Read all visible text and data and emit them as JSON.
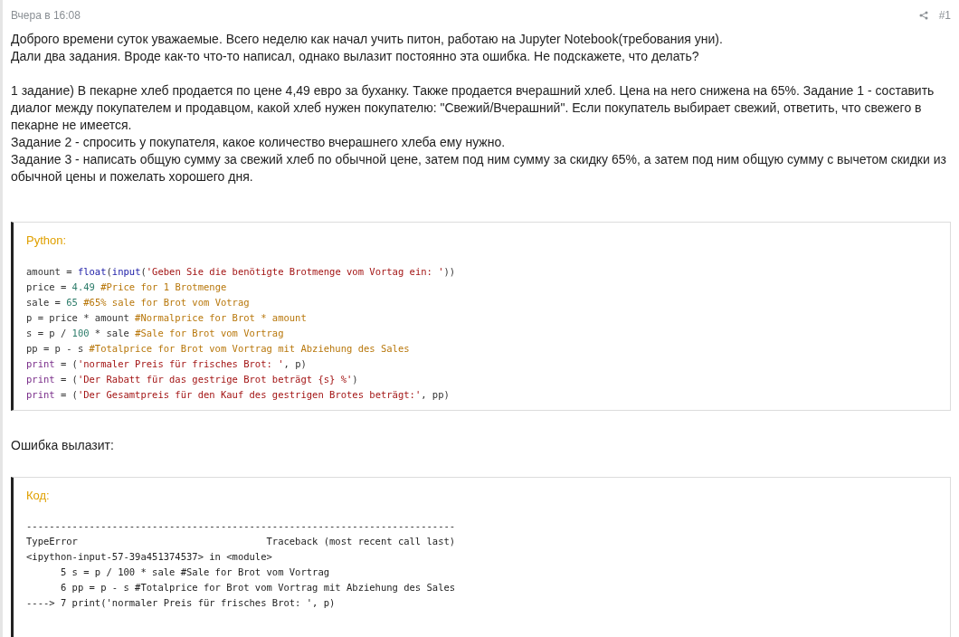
{
  "post": {
    "time": "Вчера в 16:08",
    "number": "#1"
  },
  "paragraphs": [
    "Доброго времени суток уважаемые. Всего неделю как начал учить питон, работаю на Jupyter Notebook(требования уни).\nДали два задания. Вроде как-то что-то написал, однако вылазит постоянно эта ошибка. Не подскажете, что делать?",
    "1 задание) В пекарне хлеб продается по цене 4,49 евро за буханку. Также продается вчерашний хлеб. Цена на него снижена на 65%. Задание 1 - составить диалог между покупателем и продавцом, какой хлеб нужен покупателю: \"Свежий/Вчерашний\". Если покупатель выбирает свежий, ответить, что свежего в пекарне не имеется.\nЗадание 2 - спросить у покупателя, какое количество вчерашнего хлеба ему нужно.\nЗадание 3 - написать общую сумму за свежий хлеб по обычной цене, затем под ним сумму за скидку 65%, а затем под ним общую сумму с вычетом скидки из обычной цены и пожелать хорошего дня."
  ],
  "code_block": {
    "label": "Python:",
    "lines": [
      [
        {
          "kind": "plain",
          "text": "amount = "
        },
        {
          "kind": "builtin",
          "text": "float"
        },
        {
          "kind": "plain",
          "text": "("
        },
        {
          "kind": "builtin",
          "text": "input"
        },
        {
          "kind": "plain",
          "text": "("
        },
        {
          "kind": "string",
          "text": "'Geben Sie die benötigte Brotmenge vom Vortag ein: '"
        },
        {
          "kind": "plain",
          "text": "))"
        }
      ],
      [
        {
          "kind": "plain",
          "text": "price = "
        },
        {
          "kind": "number",
          "text": "4.49"
        },
        {
          "kind": "comment",
          "text": " #Price for 1 Brotmenge"
        }
      ],
      [
        {
          "kind": "plain",
          "text": "sale = "
        },
        {
          "kind": "number",
          "text": "65"
        },
        {
          "kind": "comment",
          "text": " #65% sale for Brot vom Votrag"
        }
      ],
      [
        {
          "kind": "plain",
          "text": "p = price * amount "
        },
        {
          "kind": "comment",
          "text": "#Normalprice for Brot * amount"
        }
      ],
      [
        {
          "kind": "plain",
          "text": "s = p / "
        },
        {
          "kind": "number",
          "text": "100"
        },
        {
          "kind": "plain",
          "text": " * sale "
        },
        {
          "kind": "comment",
          "text": "#Sale for Brot vom Vortrag"
        }
      ],
      [
        {
          "kind": "plain",
          "text": "pp = p - s "
        },
        {
          "kind": "comment",
          "text": "#Totalprice for Brot vom Vortrag mit Abziehung des Sales"
        }
      ],
      [
        {
          "kind": "keyword",
          "text": "print"
        },
        {
          "kind": "plain",
          "text": " = ("
        },
        {
          "kind": "string",
          "text": "'normaler Preis für frisches Brot: '"
        },
        {
          "kind": "plain",
          "text": ", p)"
        }
      ],
      [
        {
          "kind": "keyword",
          "text": "print"
        },
        {
          "kind": "plain",
          "text": " = ("
        },
        {
          "kind": "string",
          "text": "'Der Rabatt für das gestrige Brot beträgt {s} %'"
        },
        {
          "kind": "plain",
          "text": ")"
        }
      ],
      [
        {
          "kind": "keyword",
          "text": "print"
        },
        {
          "kind": "plain",
          "text": " = ("
        },
        {
          "kind": "string",
          "text": "'Der Gesamtpreis für den Kauf des gestrigen Brotes beträgt:'"
        },
        {
          "kind": "plain",
          "text": ", pp)"
        }
      ]
    ]
  },
  "error_caption": "Ошибка вылазит:",
  "error_block": {
    "label": "Код:",
    "lines": [
      "---------------------------------------------------------------------------",
      "TypeError                                 Traceback (most recent call last)",
      "<ipython-input-57-39a451374537> in <module>",
      "      5 s = p / 100 * sale #Sale for Brot vom Vortrag",
      "      6 pp = p - s #Totalprice for Brot vom Vortrag mit Abziehung des Sales",
      "----> 7 print('normaler Preis für frisches Brot: ', p)"
    ]
  }
}
